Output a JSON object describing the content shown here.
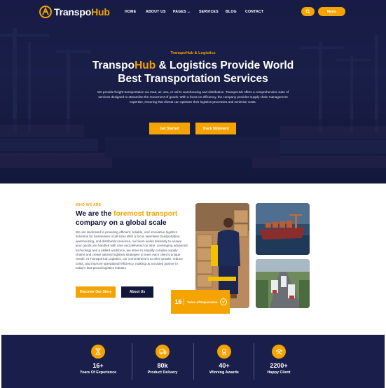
{
  "brand": {
    "name_part1": "Transpo",
    "name_part2": "Hub",
    "accent": "#f5a300",
    "dark": "#12163c"
  },
  "nav": {
    "items": [
      {
        "label": "HOME"
      },
      {
        "label": "ABOUT US"
      },
      {
        "label": "PAGES"
      },
      {
        "label": "SERVICES"
      },
      {
        "label": "BLOG"
      },
      {
        "label": "CONTACT"
      }
    ],
    "search_icon": "search-icon",
    "menu_label": "Menu"
  },
  "hero": {
    "tagline": "TranspoHub & Logistics",
    "title_part1": "Transpo",
    "title_accent": "Hub",
    "title_part2": " & Logistics Provide World",
    "title_line2": "Best Transportation Services",
    "description": "We provide freight transportation via road, air, sea, or rail to warehousing and distribution. TranspoHub offers a comprehensive suite of services designed to streamline the movement of goods. With a focus on efficiency, the company provides supply chain management expertise, ensuring that clients can optimize their logistics processes and minimize costs.",
    "btn_primary": "Get Started",
    "btn_secondary": "Track Shipment"
  },
  "about": {
    "eyebrow": "WHO WE ARE",
    "title_part1": "We are the ",
    "title_accent": "foremost transport",
    "title_line2": "company on a global scale",
    "description": "We are dedicated to providing efficient, reliable, and innovative logistics solutions for businesses of all sizes.With a focus seamless transportation, warehousing, and distribution services, our team works tirelessly to ensure your goods are handled with care and delivered on time. Leveraging advanced technology and a skilled workforce, we strive to simplify complex supply chains and create tailored logistics strategies to meet each client's unique needs. At TranspoHub Logistics, our commitment is to drive growth, reduce costs, and improve operational efficiency, making us a trusted partner in today's fast-paced logistics industry",
    "btn_primary": "Discover Our Story",
    "btn_secondary": "About Us",
    "years_number": "16",
    "years_label": "Years of Experience"
  },
  "stats": [
    {
      "value": "16+",
      "label": "Years Of Experience",
      "icon": "hourglass-icon"
    },
    {
      "value": "80k",
      "label": "Product Delivery",
      "icon": "delivery-icon"
    },
    {
      "value": "40+",
      "label": "Winning Awards",
      "icon": "award-icon"
    },
    {
      "value": "2200+",
      "label": "Happy Client",
      "icon": "users-icon"
    }
  ]
}
